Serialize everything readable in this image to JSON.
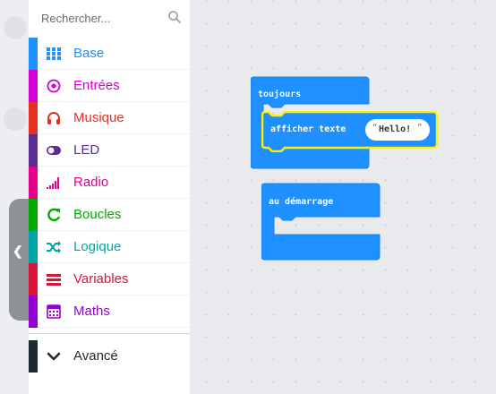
{
  "search": {
    "placeholder": "Rechercher..."
  },
  "categories": [
    {
      "label": "Base",
      "color": "#1e90ff",
      "icon": "grid-icon"
    },
    {
      "label": "Entrées",
      "color": "#d400d4",
      "icon": "target-icon"
    },
    {
      "label": "Musique",
      "color": "#e63022",
      "icon": "headphones-icon"
    },
    {
      "label": "LED",
      "color": "#5c2d91",
      "icon": "toggle-icon"
    },
    {
      "label": "Radio",
      "color": "#e3008c",
      "icon": "signal-icon"
    },
    {
      "label": "Boucles",
      "color": "#00aa00",
      "icon": "refresh-icon"
    },
    {
      "label": "Logique",
      "color": "#00a4a6",
      "icon": "shuffle-icon"
    },
    {
      "label": "Variables",
      "color": "#dc143c",
      "icon": "lines-icon"
    },
    {
      "label": "Maths",
      "color": "#9400d3",
      "icon": "calculator-icon"
    }
  ],
  "advanced": {
    "label": "Avancé",
    "color": "#1c2a32",
    "icon": "chevron-down-icon"
  },
  "blocks": {
    "forever_label": "toujours",
    "show_string_label": "afficher texte",
    "string_value": "Hello!",
    "on_start_label": "au démarrage"
  },
  "colors": {
    "block_blue": "#1e90ff",
    "highlight": "#fff200"
  }
}
